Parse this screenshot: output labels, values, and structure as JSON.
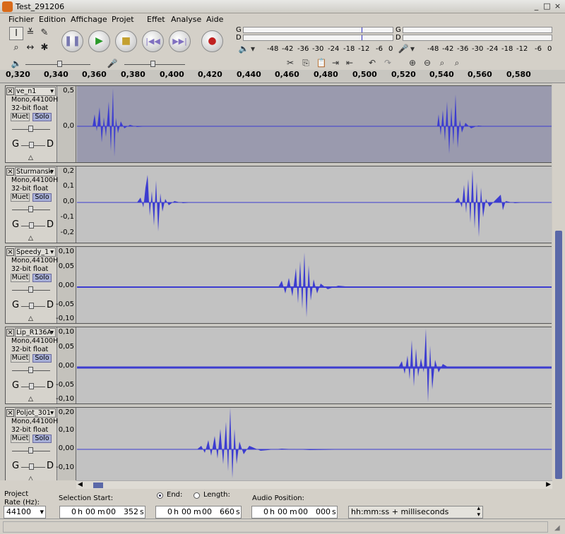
{
  "window": {
    "title": "Test_291206",
    "app_icon": "audacity-icon"
  },
  "menu": [
    "Fichier",
    "Edition",
    "Affichage",
    "Projet",
    "Effet",
    "Analyse",
    "Aide"
  ],
  "meters": {
    "left_label": "G",
    "right_label": "D",
    "ticks": [
      "-48",
      "-42",
      "-36",
      "-30",
      "-24",
      "-18",
      "-12",
      "-6",
      "0"
    ]
  },
  "ruler": {
    "labels": [
      "0,320",
      "0,340",
      "0,360",
      "0,380",
      "0,400",
      "0,420",
      "0,440",
      "0,460",
      "0,480",
      "0,500",
      "0,520",
      "0,540",
      "0,560",
      "0,580"
    ]
  },
  "track_common": {
    "format": "Mono,44100Hz",
    "depth": "32-bit float",
    "mute": "Muet",
    "solo": "Solo",
    "gain_left": "G",
    "gain_right": "D"
  },
  "tracks": [
    {
      "name": "ve_n1",
      "scale": [
        "0,5",
        "0,0"
      ]
    },
    {
      "name": "Sturmansk",
      "scale": [
        "0,2",
        "0,1",
        "0,0",
        "-0,1",
        "-0,2"
      ]
    },
    {
      "name": "Speedy_1",
      "scale": [
        "0,10",
        "0,05",
        "0,00",
        "-0,05",
        "-0,10"
      ]
    },
    {
      "name": "Lip_R136A",
      "scale": [
        "0,10",
        "0,05",
        "0,00",
        "-0,05",
        "-0,10"
      ]
    },
    {
      "name": "Poljot_301",
      "scale": [
        "0,20",
        "0,10",
        "0,00",
        "-0,10"
      ]
    }
  ],
  "selection": {
    "project_rate_label": "Project Rate (Hz):",
    "project_rate_value": "44100",
    "start_label": "Selection Start:",
    "end_label": "End:",
    "length_label": "Length:",
    "audio_pos_label": "Audio Position:",
    "start": {
      "h": "0",
      "m": "00",
      "s": "00",
      "ms": "352"
    },
    "end": {
      "h": "0",
      "m": "00",
      "s": "00",
      "ms": "660"
    },
    "pos": {
      "h": "0",
      "m": "00",
      "s": "00",
      "ms": "000"
    },
    "format": "hh:mm:ss + milliseconds",
    "unit_h": "h",
    "unit_m": "m",
    "unit_s": "s"
  },
  "colors": {
    "wave": "#3c3cd0",
    "selected_bg": "#9a9aae",
    "track_bg": "#c2c2c2",
    "scroll": "#5a68a8"
  }
}
